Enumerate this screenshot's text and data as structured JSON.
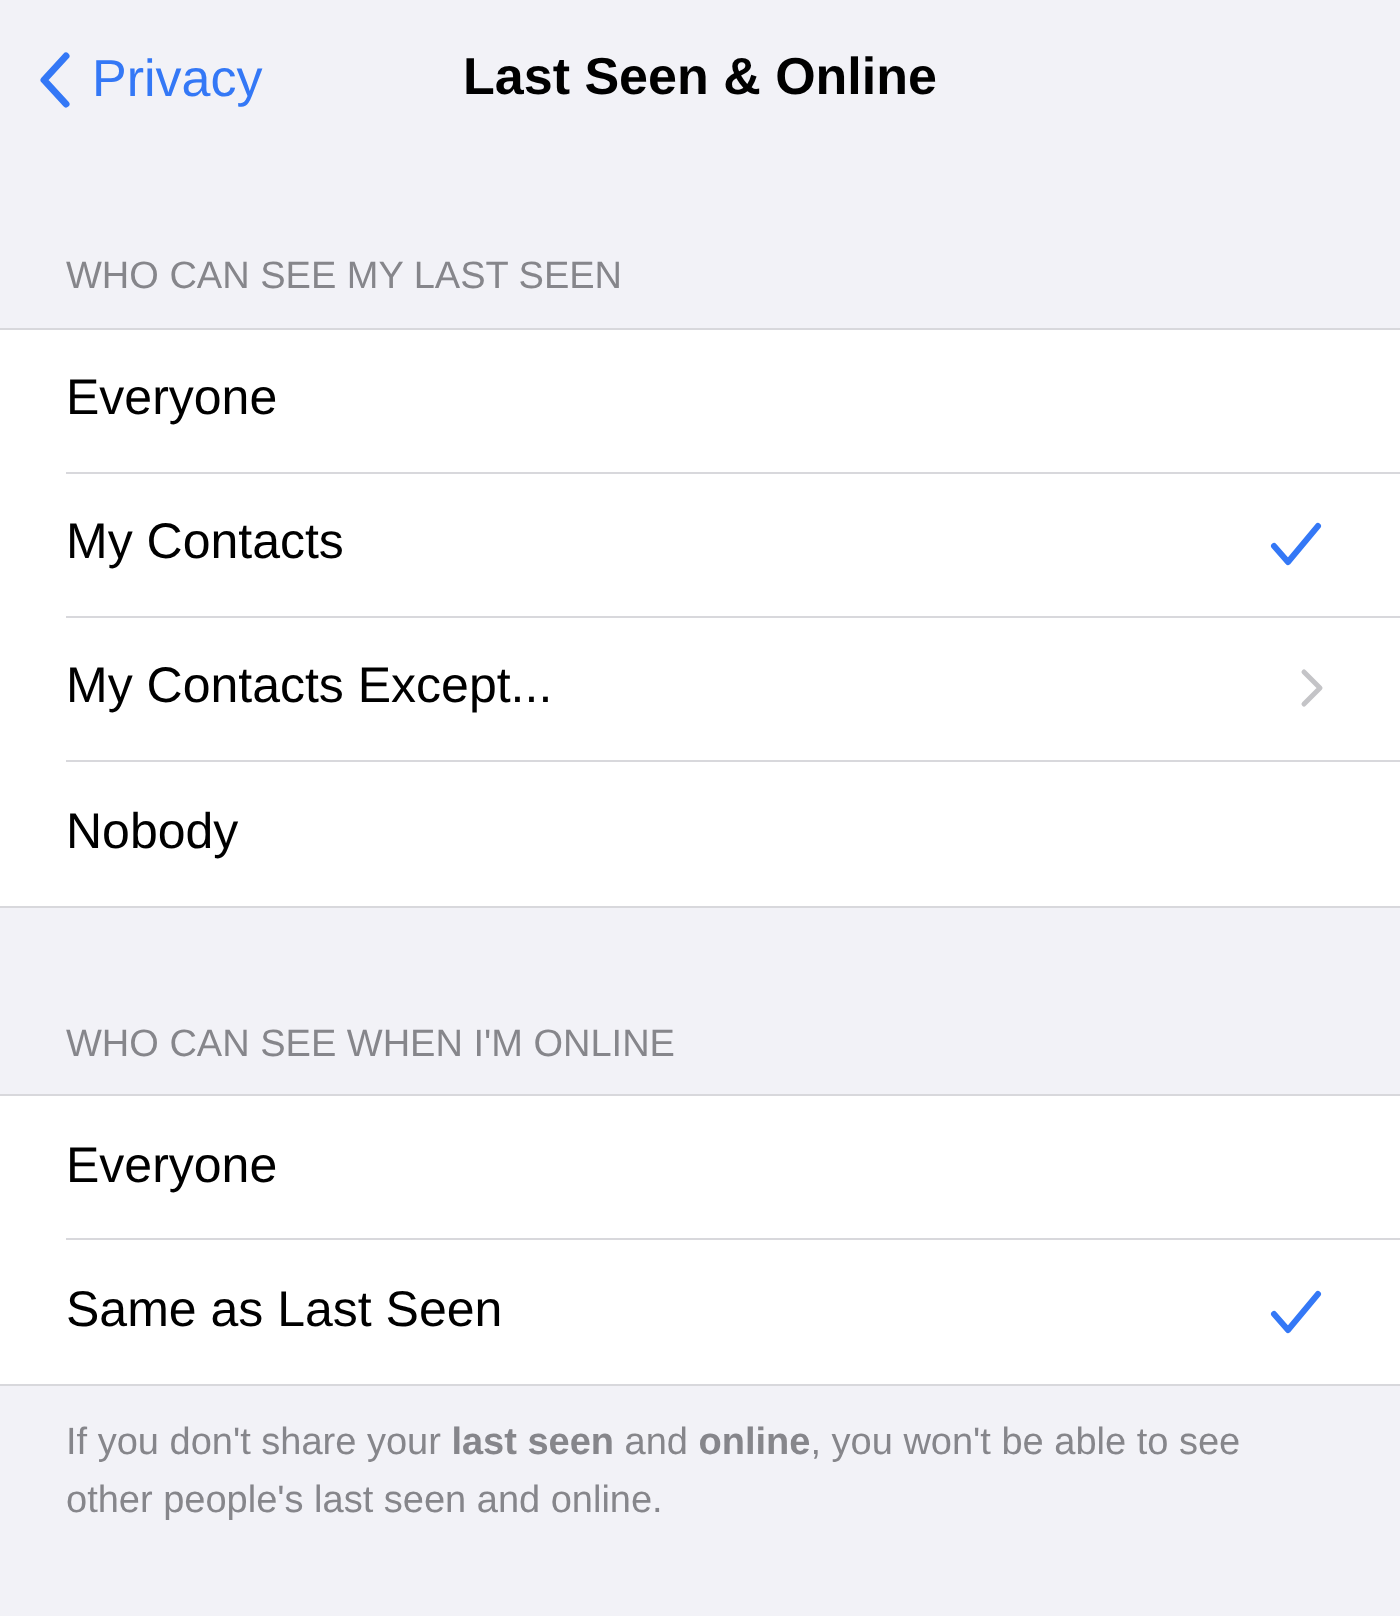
{
  "nav": {
    "back": "Privacy",
    "title": "Last Seen & Online"
  },
  "sections": [
    {
      "header": "WHO CAN SEE MY LAST SEEN",
      "rows": [
        {
          "label": "Everyone",
          "kind": "option",
          "selected": false
        },
        {
          "label": "My Contacts",
          "kind": "option",
          "selected": true
        },
        {
          "label": "My Contacts Except...",
          "kind": "disclosure",
          "selected": false
        },
        {
          "label": "Nobody",
          "kind": "option",
          "selected": false
        }
      ]
    },
    {
      "header": "WHO CAN SEE WHEN I'M ONLINE",
      "rows": [
        {
          "label": "Everyone",
          "kind": "option",
          "selected": false
        },
        {
          "label": "Same as Last Seen",
          "kind": "option",
          "selected": true
        }
      ],
      "footer": "If you don't share your **last seen** and **online**, you won't be able to see other people's last seen and online."
    }
  ]
}
